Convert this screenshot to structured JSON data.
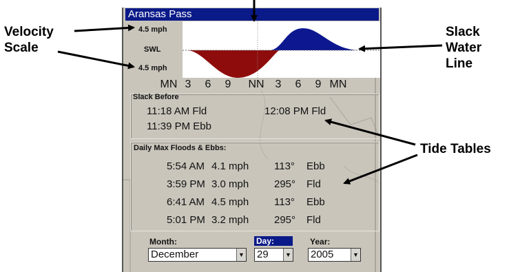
{
  "callouts": {
    "velocity_line1": "Velocity",
    "velocity_line2": "Scale",
    "slack_line1": "Slack",
    "slack_line2": "Water",
    "slack_line3": "Line",
    "tide_tables": "Tide Tables"
  },
  "window": {
    "title": "Aransas Pass"
  },
  "graph": {
    "scale_top": "4.5 mph",
    "scale_mid": "SWL",
    "scale_bottom": "4.5 mph",
    "x_ticks": [
      "MN",
      "3",
      "6",
      "9",
      "NN",
      "3",
      "6",
      "9",
      "MN"
    ],
    "colors": {
      "flood": "#0c1790",
      "ebb": "#8f0c0c"
    }
  },
  "slack": {
    "title": "Slack Before",
    "left1": "11:18 AM Fld",
    "left2": "11:39 PM Ebb",
    "right1": "12:08 PM Fld"
  },
  "daily": {
    "title": "Daily Max Floods & Ebbs:",
    "rows": [
      {
        "time": "5:54 AM",
        "speed": "4.1 mph",
        "dir": "113°",
        "type": "Ebb"
      },
      {
        "time": "3:59 PM",
        "speed": "3.0 mph",
        "dir": "295°",
        "type": "Fld"
      },
      {
        "time": "6:41 AM",
        "speed": "4.5 mph",
        "dir": "113°",
        "type": "Ebb"
      },
      {
        "time": "5:01 PM",
        "speed": "3.2 mph",
        "dir": "295°",
        "type": "Fld"
      }
    ]
  },
  "date": {
    "month_label": "Month:",
    "month_value": "December",
    "day_label": "Day:",
    "day_value": "29",
    "year_label": "Year:",
    "year_value": "2005"
  }
}
